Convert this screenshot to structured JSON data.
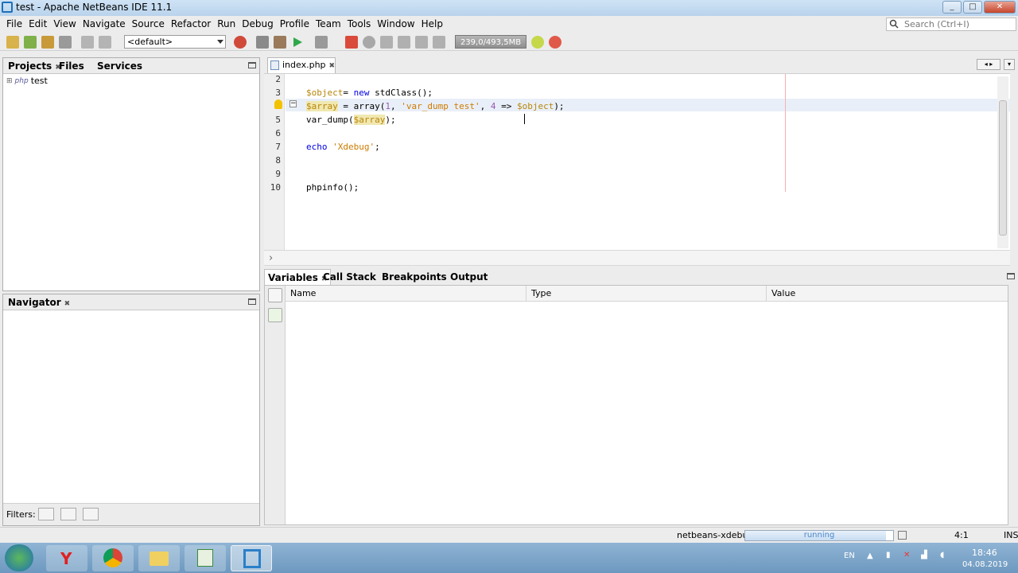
{
  "window": {
    "title": "test - Apache NetBeans IDE 11.1",
    "minimize": "_",
    "maximize": "□",
    "close": "✕"
  },
  "menu": [
    "File",
    "Edit",
    "View",
    "Navigate",
    "Source",
    "Refactor",
    "Run",
    "Debug",
    "Profile",
    "Team",
    "Tools",
    "Window",
    "Help"
  ],
  "search": {
    "placeholder": "Search (Ctrl+I)"
  },
  "toolbar": {
    "config": "<default>",
    "memory": "239,0/493,5MB"
  },
  "left_panel": {
    "tabs": [
      "Projects",
      "Files",
      "Services"
    ],
    "tree_root": "test",
    "tree_badge": "php"
  },
  "navigator": {
    "title": "Navigator"
  },
  "filters": {
    "label": "Filters:"
  },
  "editor": {
    "tab": "index.php",
    "lines": [
      {
        "n": "2",
        "parts": []
      },
      {
        "n": "3",
        "parts": [
          [
            "var",
            "$object"
          ],
          [
            "",
            ""
          ],
          [
            "",
            "= "
          ],
          [
            "kw",
            "new"
          ],
          [
            "",
            " stdClass();"
          ]
        ]
      },
      {
        "n": "4",
        "parts": [
          [
            "var hl",
            "$array"
          ],
          [
            "",
            " = array("
          ],
          [
            "num",
            "1"
          ],
          [
            "",
            ", "
          ],
          [
            "str",
            "'var_dump test'"
          ],
          [
            "",
            ", "
          ],
          [
            "num",
            "4"
          ],
          [
            "",
            " => "
          ],
          [
            "var",
            "$object"
          ],
          [
            "",
            ");"
          ]
        ]
      },
      {
        "n": "5",
        "parts": [
          [
            "",
            "var_dump("
          ],
          [
            "var hl",
            "$array"
          ],
          [
            "",
            ");"
          ]
        ]
      },
      {
        "n": "6",
        "parts": []
      },
      {
        "n": "7",
        "parts": [
          [
            "kw",
            "echo"
          ],
          [
            "",
            " "
          ],
          [
            "str",
            "'Xdebug'"
          ],
          [
            "",
            ";"
          ]
        ]
      },
      {
        "n": "8",
        "parts": []
      },
      {
        "n": "9",
        "parts": []
      },
      {
        "n": "10",
        "parts": [
          [
            "",
            "phpinfo();"
          ]
        ]
      }
    ]
  },
  "debugger": {
    "tabs": [
      "Variables",
      "Call Stack",
      "Breakpoints",
      "Output"
    ],
    "columns": [
      "Name",
      "Type",
      "Value"
    ]
  },
  "status": {
    "session": "netbeans-xdebug",
    "progress_label": "running",
    "progress": 0.95,
    "position": "4:1",
    "mode": "INS"
  },
  "taskbar": {
    "lang": "EN",
    "time": "18:46",
    "date": "04.08.2019"
  },
  "colors": {
    "variable": "#b8860b",
    "keyword": "#0000e6",
    "string": "#ce7b00",
    "number": "#9b59b6"
  }
}
